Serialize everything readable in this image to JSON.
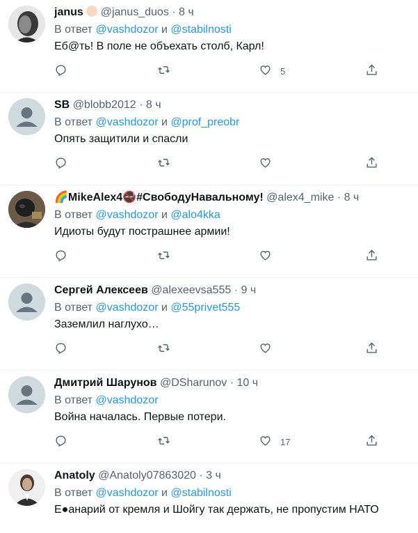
{
  "reply_prefix": "В ответ",
  "conjunction": "и",
  "dot": "·",
  "colors": {
    "link": "#1d9bf0",
    "muted": "#536471",
    "text": "#0f1419"
  },
  "tweets": [
    {
      "name": "janus",
      "handle": "@janus_duos",
      "time": "8 ч",
      "reply_to": [
        "@vashdozor",
        "@stabilnosti"
      ],
      "text": "Еб@ть! В поле не объехать столб, Карл!",
      "likes": "5"
    },
    {
      "name": "SB",
      "handle": "@blobb2012",
      "time": "8 ч",
      "reply_to": [
        "@vashdozor",
        "@prof_preobr"
      ],
      "text": "Опять защитили и спасли",
      "likes": ""
    },
    {
      "name": "🌈MikeAlex4🚭#СвободуНавальному!",
      "handle": "@alex4_mike",
      "time": "8 ч",
      "reply_to": [
        "@vashdozor",
        "@alo4kka"
      ],
      "text": "Идиоты будут пострашнее армии!",
      "likes": ""
    },
    {
      "name": "Сергей Алексеев",
      "handle": "@alexeevsa555",
      "time": "9 ч",
      "reply_to": [
        "@vashdozor",
        "@55privet555"
      ],
      "text": "Заземлил наглухо…",
      "likes": ""
    },
    {
      "name": "Дмитрий Шарунов",
      "handle": "@DSharunov",
      "time": "10 ч",
      "reply_to": [
        "@vashdozor"
      ],
      "text": "Война началась. Первые потери.",
      "likes": "17"
    },
    {
      "name": "Anatoly",
      "handle": "@Anatoly07863020",
      "time": "3 ч",
      "reply_to": [
        "@vashdozor",
        "@stabilnosti"
      ],
      "text": "Е●анарий от кремля и Шойгу так держать, не пропустим НАТО",
      "likes": ""
    }
  ],
  "icons": {
    "reply": "reply-icon",
    "retweet": "retweet-icon",
    "like": "heart-icon",
    "share": "share-icon"
  }
}
